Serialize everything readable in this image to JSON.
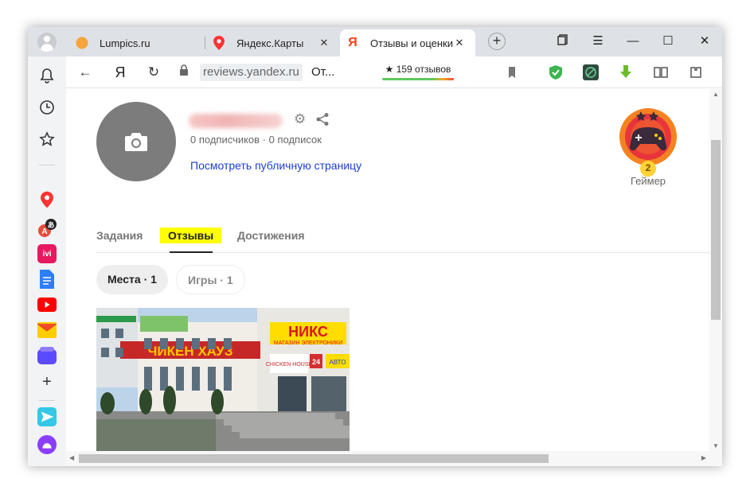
{
  "browser": {
    "tabs": [
      {
        "label": "Lumpics.ru"
      },
      {
        "label": "Яндекс.Карты",
        "close": "✕"
      },
      {
        "label": "Отзывы и оценки",
        "close": "✕"
      }
    ],
    "new_tab": "+",
    "window_controls": {
      "minimize": "—",
      "maximize": "☐",
      "close": "✕"
    }
  },
  "addressbar": {
    "back": "←",
    "logo": "Я",
    "reload": "↻",
    "host": "reviews.yandex.ru",
    "page_title": "От...",
    "rating_text": "★ 159 отзывов"
  },
  "sidebar": {
    "add": "+",
    "ivi_label": "ivi"
  },
  "profile": {
    "subscribers": "0 подписчиков · 0 подписок",
    "public_link": "Посмотреть публичную страницу",
    "badge_label": "Геймер",
    "badge_level": "2"
  },
  "page_tabs": [
    {
      "label": "Задания"
    },
    {
      "label": "Отзывы"
    },
    {
      "label": "Достижения"
    }
  ],
  "filters": [
    {
      "label": "Места · 1"
    },
    {
      "label": "Игры · 1"
    }
  ],
  "photo": {
    "sign_left": "ЧИКЕН ХАУЗ",
    "sign_right_top": "НИКС",
    "sign_right_sub": "МАГАЗИН ЭЛЕКТРОНИКИ",
    "sign_small": "CHICKEN HOUSE",
    "sign_24": "24",
    "sign_auto": "АВТО"
  },
  "colors": {
    "accent_yellow": "#ffff00",
    "link_blue": "#1a3ed6",
    "badge_orange": "#f58220",
    "badge_red": "#e8343c"
  }
}
